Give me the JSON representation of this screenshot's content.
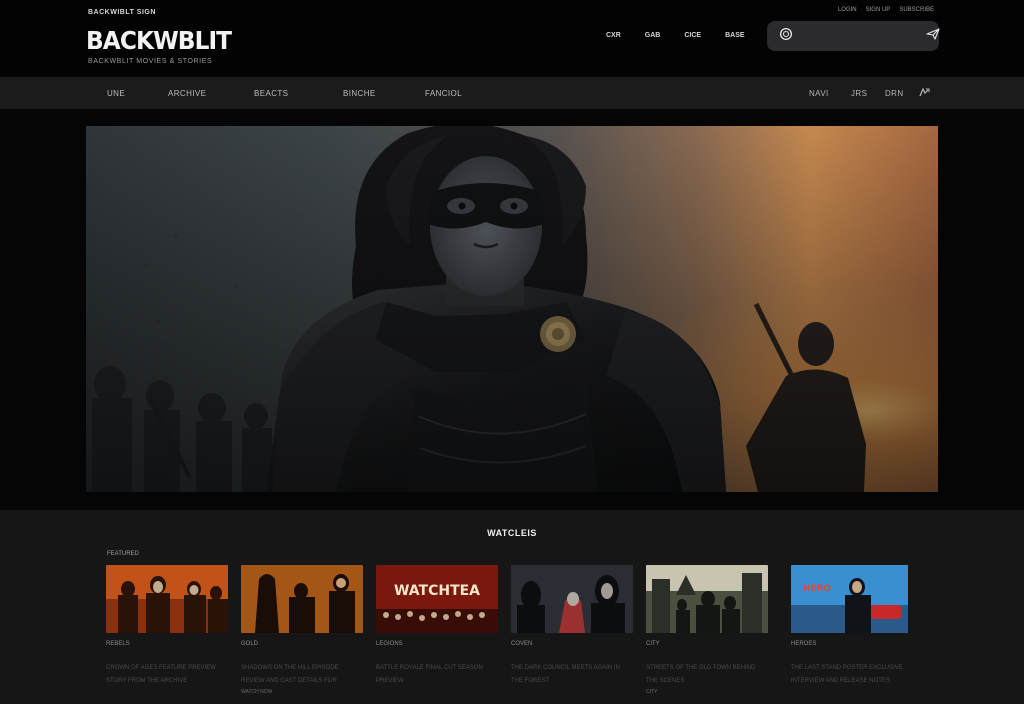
{
  "header": {
    "eyebrow": "BACKWIBLT SIGN",
    "logo": "BACKWBLIT",
    "tagline": "BACKWBLIT MOVIES & STORIES",
    "top_links": [
      "LOGIN",
      "SIGN UP",
      "SUBSCRIBE"
    ],
    "nav": [
      "CXR",
      "GAB",
      "CICE",
      "BASE"
    ],
    "search": {
      "placeholder": ""
    }
  },
  "subnav": {
    "left": [
      "UNE",
      "ARCHIVE",
      "BEACTS",
      "BINCHE",
      "FANCIOL"
    ],
    "right": [
      "NAVI",
      "JRS",
      "DRN"
    ]
  },
  "hero": {
    "image_alt": ""
  },
  "section": {
    "title": "WATCLEIS",
    "label": "FEATURED",
    "cards": [
      {
        "title": "REBELS",
        "desc": "CROWN OF AGES FEATURE PREVIEW STORY FROM THE ARCHIVE",
        "more": "",
        "tag": ""
      },
      {
        "title": "GOLD",
        "desc": "SHADOWS ON THE HILL EPISODE REVIEW AND CAST DETAILS FOR",
        "more": "WATCH NOW",
        "tag": ""
      },
      {
        "title": "LEGIONS",
        "desc": "BATTLE ROYALE FINAL CUT SEASON PREVIEW",
        "more": "",
        "tag": "WATCHTEA"
      },
      {
        "title": "COVEN",
        "desc": "THE DARK COUNCIL MEETS AGAIN IN THE FOREST",
        "more": "",
        "tag": ""
      },
      {
        "title": "CITY",
        "desc": "STREETS OF THE OLD TOWN BEHIND THE SCENES",
        "more": "CITY",
        "tag": ""
      },
      {
        "title": "HEROES",
        "desc": "THE LAST STAND POSTER EXCLUSIVE INTERVIEW AND RELEASE NOTES",
        "more": "",
        "tag": "HERO"
      }
    ]
  },
  "colors": {
    "background": "#050505",
    "panel": "#161617",
    "subnav": "#1b1b1c",
    "search": "#2b2b2d",
    "accent_sunset": "#c5884f"
  }
}
